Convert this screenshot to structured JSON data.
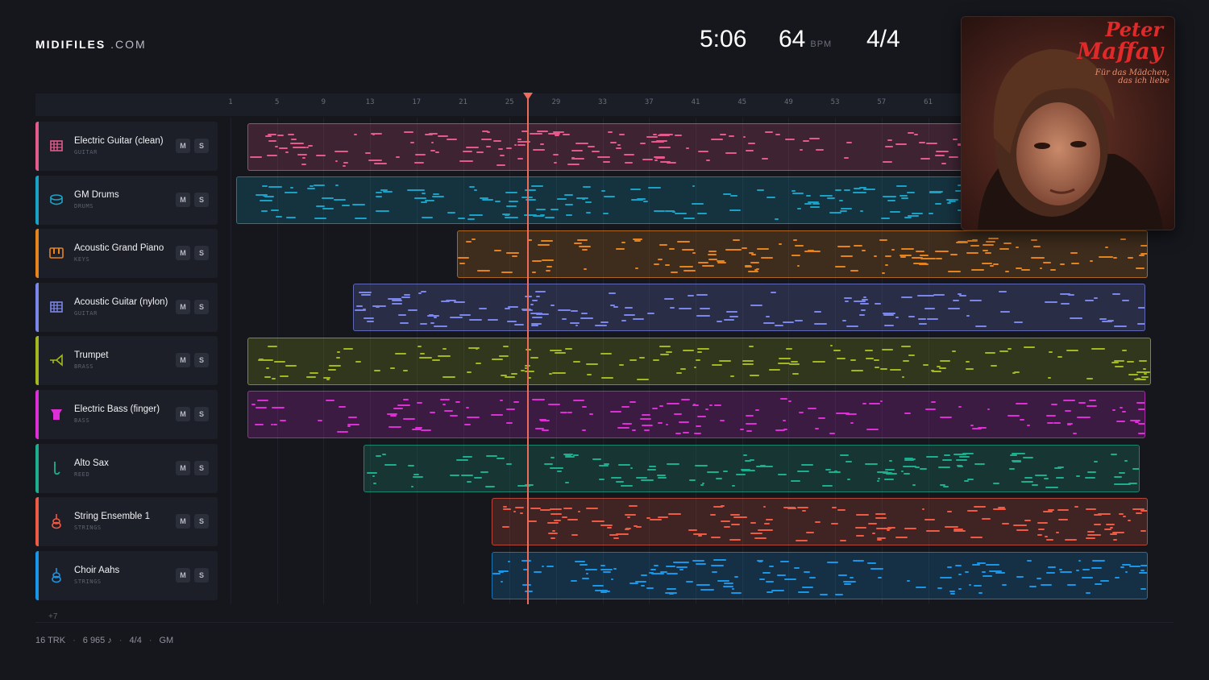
{
  "brand": {
    "name": "MIDIFILES",
    "suffix": ".COM"
  },
  "header": {
    "time": "5:06",
    "bpm": "64",
    "bpm_unit": "BPM",
    "signature": "4/4"
  },
  "ruler": {
    "ticks": [
      "1",
      "5",
      "9",
      "13",
      "17",
      "21",
      "25",
      "29",
      "33",
      "37",
      "41",
      "45",
      "49",
      "53",
      "57",
      "61"
    ]
  },
  "tracks": [
    {
      "name": "Electric Guitar (clean)",
      "category": "GUITAR",
      "color": "#e45a8a",
      "icon": "guitar-icon",
      "mute": "M",
      "solo": "S"
    },
    {
      "name": "GM Drums",
      "category": "DRUMS",
      "color": "#1aa2c6",
      "icon": "drum-icon",
      "mute": "M",
      "solo": "S"
    },
    {
      "name": "Acoustic Grand Piano",
      "category": "KEYS",
      "color": "#e5841f",
      "icon": "piano-icon",
      "mute": "M",
      "solo": "S"
    },
    {
      "name": "Acoustic Guitar (nylon)",
      "category": "GUITAR",
      "color": "#7b86ea",
      "icon": "guitar-icon",
      "mute": "M",
      "solo": "S"
    },
    {
      "name": "Trumpet",
      "category": "BRASS",
      "color": "#a3b820",
      "icon": "trumpet-icon",
      "mute": "M",
      "solo": "S"
    },
    {
      "name": "Electric Bass (finger)",
      "category": "BASS",
      "color": "#dc2fd6",
      "icon": "bass-icon",
      "mute": "M",
      "solo": "S"
    },
    {
      "name": "Alto Sax",
      "category": "REED",
      "color": "#1dae8e",
      "icon": "sax-icon",
      "mute": "M",
      "solo": "S"
    },
    {
      "name": "String Ensemble 1",
      "category": "STRINGS",
      "color": "#ee5a43",
      "icon": "violin-icon",
      "mute": "M",
      "solo": "S"
    },
    {
      "name": "Choir Aahs",
      "category": "STRINGS",
      "color": "#1a96e8",
      "icon": "violin-icon",
      "mute": "M",
      "solo": "S"
    }
  ],
  "more_tracks": "+7",
  "footer": {
    "tracks": "16 TRK",
    "notes": "6 965 ♪",
    "signature": "4/4",
    "standard": "GM"
  },
  "cover": {
    "artist": "Peter Maffay",
    "title_line1": "Für das Mädchen,",
    "title_line2": "das ich liebe"
  }
}
